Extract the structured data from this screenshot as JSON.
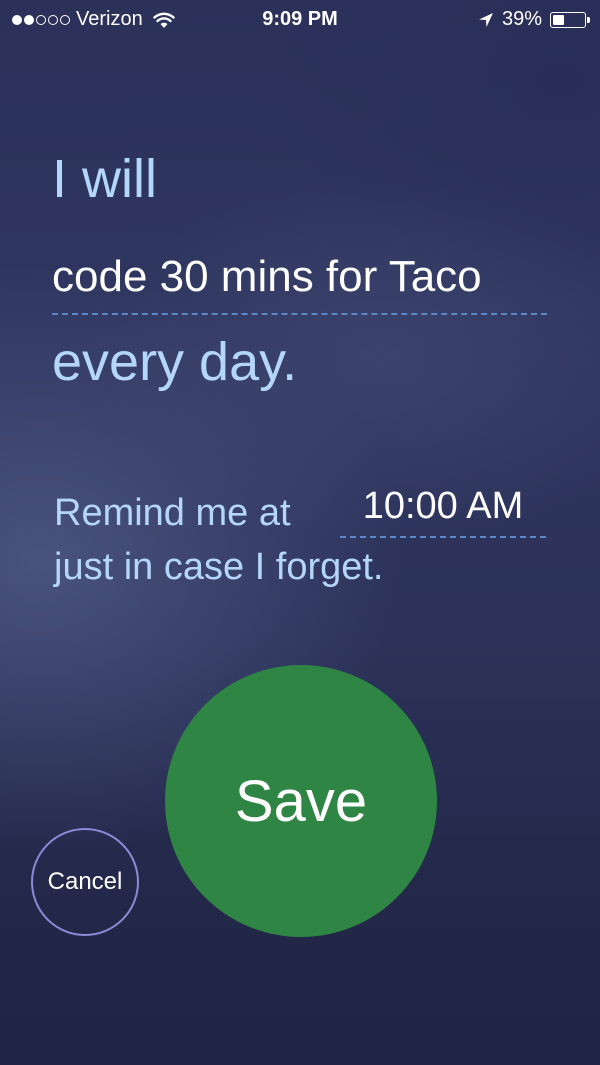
{
  "status_bar": {
    "signal_filled": 2,
    "signal_total": 5,
    "carrier": "Verizon",
    "time": "9:09 PM",
    "battery_percent": "39%",
    "battery_level": 0.39,
    "icons": [
      "wifi-icon",
      "location-arrow-icon",
      "battery-icon"
    ]
  },
  "goal": {
    "intro": "I will",
    "text": "code 30 mins for Taco",
    "frequency": "every day."
  },
  "reminder": {
    "prefix": "Remind me at",
    "time": "10:00 AM",
    "suffix": "just in case I forget."
  },
  "actions": {
    "save_label": "Save",
    "cancel_label": "Cancel"
  },
  "colors": {
    "accent_text": "#b4d6fb",
    "save_green": "#2f8543",
    "cancel_ring": "#8a8ad6",
    "field_underline": "#5c88c8"
  }
}
